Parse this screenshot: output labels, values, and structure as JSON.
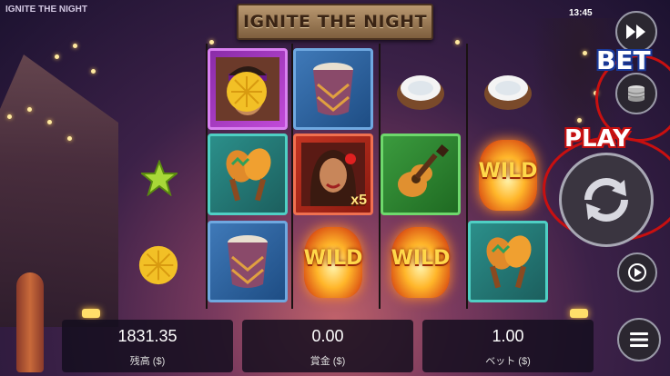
{
  "app_name": "IGNITE THE NIGHT",
  "game_title": "IGNITE THE NIGHT",
  "clock": "13:45",
  "reels": [
    [
      {
        "symbol": "man-portrait",
        "frame": "purple"
      },
      {
        "symbol": "maracas",
        "frame": "teal"
      },
      {
        "symbol": "drum",
        "frame": "blue"
      }
    ],
    [
      {
        "symbol": "drum",
        "frame": "blue"
      },
      {
        "symbol": "woman-portrait",
        "frame": "red",
        "multiplier": "x5"
      },
      {
        "symbol": "wild",
        "label": "WILD"
      }
    ],
    [
      {
        "symbol": "coconut",
        "frame": "none"
      },
      {
        "symbol": "guitar",
        "frame": "green"
      },
      {
        "symbol": "wild",
        "label": "WILD"
      }
    ],
    [
      {
        "symbol": "coconut",
        "frame": "none"
      },
      {
        "symbol": "wild",
        "label": "WILD"
      },
      {
        "symbol": "maracas",
        "frame": "teal"
      }
    ]
  ],
  "pineapple_top": {
    "symbol": "pineapple"
  },
  "side_symbols": [
    {
      "symbol": "starfruit"
    },
    {
      "symbol": "pineapple"
    }
  ],
  "balance": {
    "value": "1831.35",
    "label": "残高 ($)"
  },
  "win": {
    "value": "0.00",
    "label": "賞金 ($)"
  },
  "bet": {
    "value": "1.00",
    "label": "ベット ($)"
  },
  "overlay": {
    "bet_label": "BET",
    "play_label": "PLAY"
  },
  "buttons": {
    "fast_forward": "fast-forward-icon",
    "coins": "coin-stack-icon",
    "spin": "spin-icon",
    "autoplay": "play-icon",
    "menu": "menu-icon"
  }
}
